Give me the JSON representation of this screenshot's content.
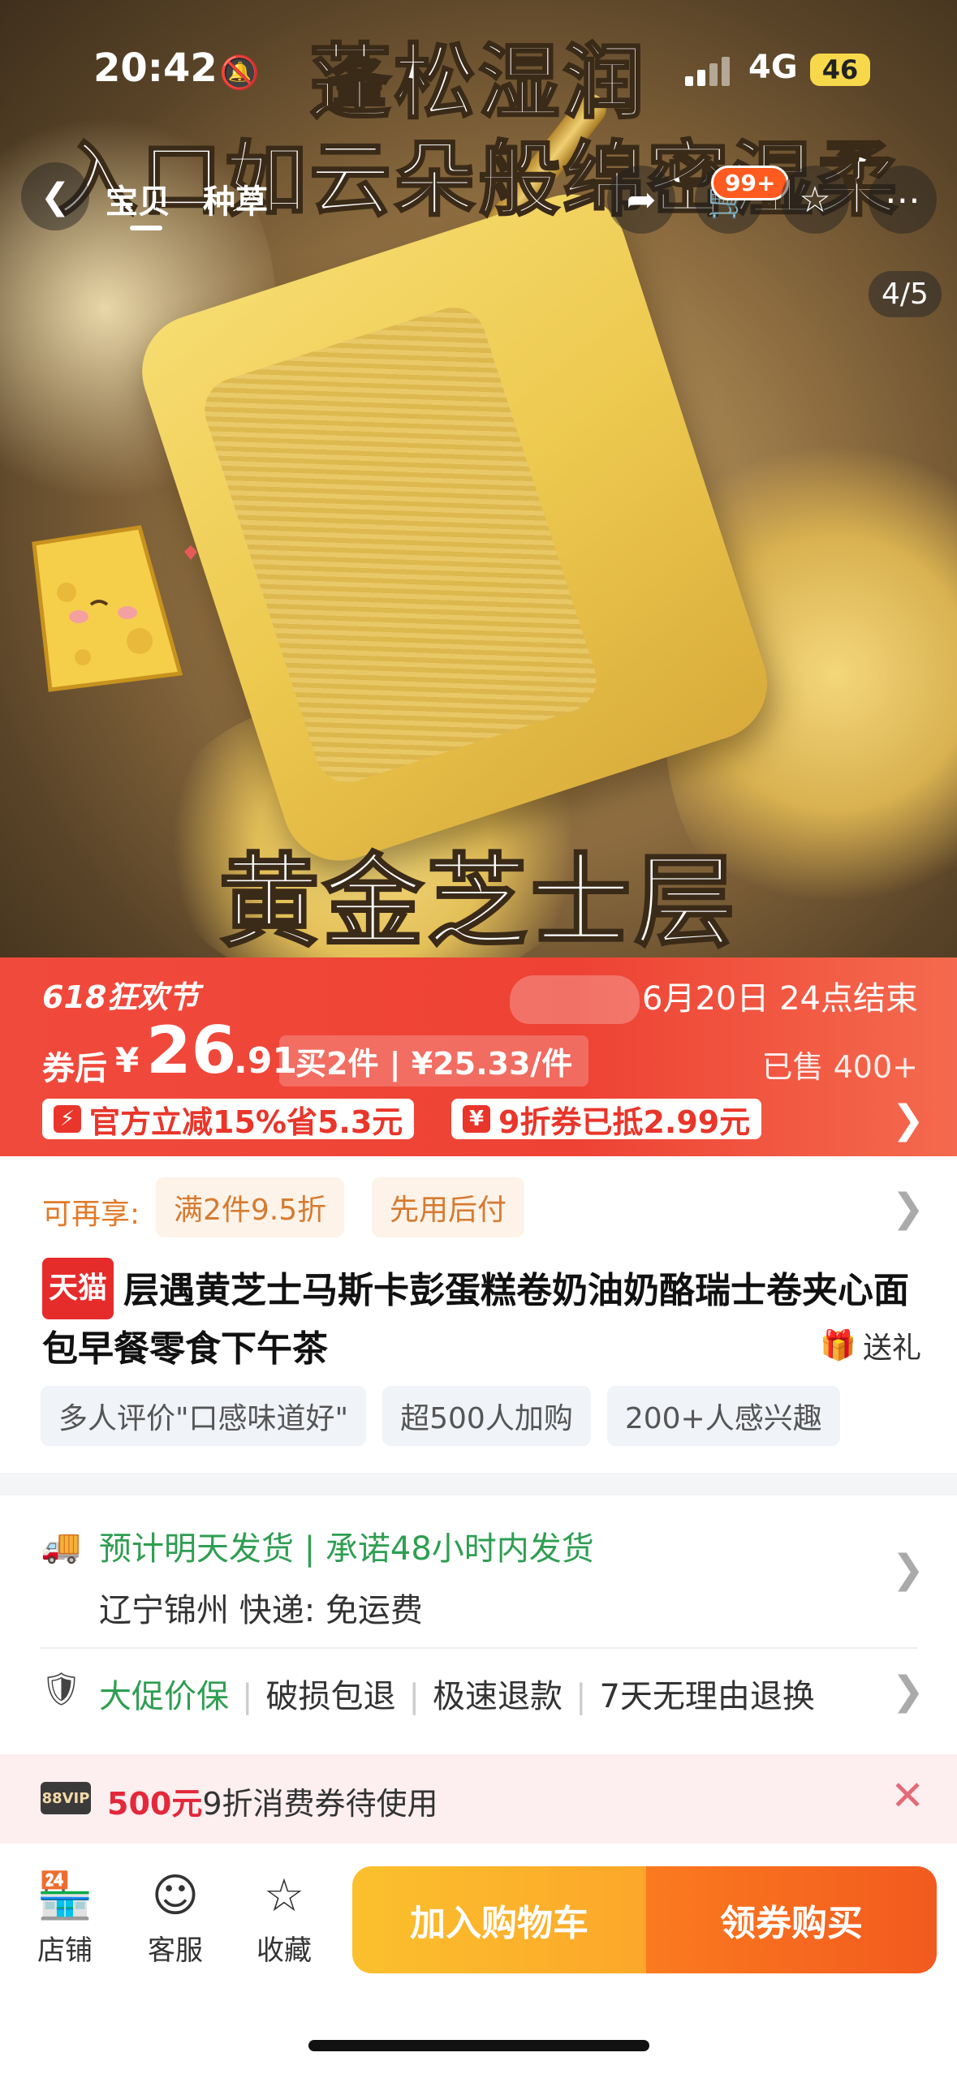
{
  "status_bar": {
    "time": "20:42",
    "network": "4G",
    "battery": "46"
  },
  "hero": {
    "caption_line1": "蓬松湿润",
    "caption_line2": "入口如云朵般绵密湿柔",
    "caption_line3": "黄金芝士层",
    "image_counter": "4/5",
    "tabs": [
      "宝贝",
      "种草"
    ],
    "cart_badge": "99+"
  },
  "promo": {
    "festival": "618狂欢节",
    "ends": "6月20日 24点结束",
    "after_label": "券后",
    "currency": "¥",
    "price_int": "26",
    "price_dec": ".91",
    "multi_buy": "买2件 | ¥25.33/件",
    "sold": "已售 400+",
    "chip1": "官方立减15%省5.3元",
    "chip2": "9折券已抵2.99元",
    "colors": {
      "accent": "#ee4234"
    }
  },
  "extra": {
    "label": "可再享:",
    "tags": [
      "满2件9.5折",
      "先用后付"
    ]
  },
  "product": {
    "tmall": "天猫",
    "title": "层遇黄芝士马斯卡彭蛋糕卷奶油奶酪瑞士卷夹心面包早餐零食下午茶",
    "gift": "送礼",
    "pills": [
      "多人评价\"口感味道好\"",
      "超500人加购",
      "200+人感兴趣"
    ]
  },
  "shipping": {
    "line1": "预计明天发货 | 承诺48小时内发货",
    "line2": "辽宁锦州  快递: 免运费"
  },
  "guarantees": {
    "items": [
      "大促价保",
      "破损包退",
      "极速退款",
      "7天无理由退换"
    ]
  },
  "vip": {
    "badge": "88VIP",
    "amount": "500元",
    "text": "9折消费券待使用"
  },
  "bottom": {
    "shop": "店铺",
    "service": "客服",
    "favorite": "收藏",
    "add_to_cart": "加入购物车",
    "buy": "领券购买"
  }
}
